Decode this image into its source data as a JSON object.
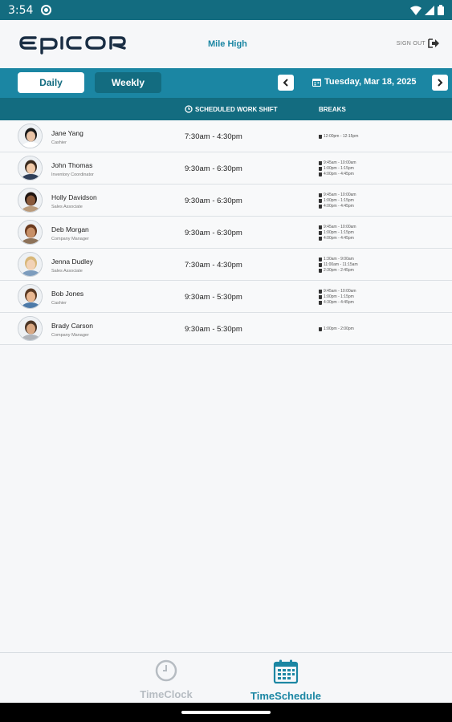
{
  "status_bar": {
    "time": "3:54"
  },
  "header": {
    "logo_text": "EPICOR",
    "store_name": "Mile High",
    "sign_out": "SIGN OUT"
  },
  "toolbar": {
    "daily_label": "Daily",
    "weekly_label": "Weekly",
    "date": "Tuesday, Mar 18, 2025"
  },
  "columns": {
    "shift": "SCHEDULED WORK SHIFT",
    "breaks": "BREAKS"
  },
  "employees": [
    {
      "name": "Jane Yang",
      "role": "Cashier",
      "shift": "7:30am - 4:30pm",
      "breaks": [
        "12:00pm - 12:15pm"
      ]
    },
    {
      "name": "John Thomas",
      "role": "Inventory Coordinator",
      "shift": "9:30am - 6:30pm",
      "breaks": [
        "9:45am - 10:00am",
        "1:00pm - 1:15pm",
        "4:00pm - 4:45pm"
      ]
    },
    {
      "name": "Holly Davidson",
      "role": "Sales Associate",
      "shift": "9:30am - 6:30pm",
      "breaks": [
        "9:45am - 10:00am",
        "1:00pm - 1:15pm",
        "4:00pm - 4:45pm"
      ]
    },
    {
      "name": "Deb Morgan",
      "role": "Company Manager",
      "shift": "9:30am - 6:30pm",
      "breaks": [
        "9:45am - 10:00am",
        "1:00pm - 1:15pm",
        "4:00pm - 4:45pm"
      ]
    },
    {
      "name": "Jenna Dudley",
      "role": "Sales Associate",
      "shift": "7:30am - 4:30pm",
      "breaks": [
        "1:30am - 9:00am",
        "11:00am - 11:15am",
        "2:30pm - 2:45pm"
      ]
    },
    {
      "name": "Bob Jones",
      "role": "Cashier",
      "shift": "9:30am - 5:30pm",
      "breaks": [
        "9:45am - 10:00am",
        "1:00pm - 1:15pm",
        "4:30pm - 4:45pm"
      ]
    },
    {
      "name": "Brady Carson",
      "role": "Company Manager",
      "shift": "9:30am - 5:30pm",
      "breaks": [
        "1:00pm - 2:00pm"
      ]
    }
  ],
  "bottom_nav": {
    "timeclock_label": "TimeClock",
    "timeschedule_label": "TimeSchedule"
  },
  "colors": {
    "primary": "#1b86a3",
    "dark": "#136c80",
    "accent_text": "#1b86a3"
  }
}
